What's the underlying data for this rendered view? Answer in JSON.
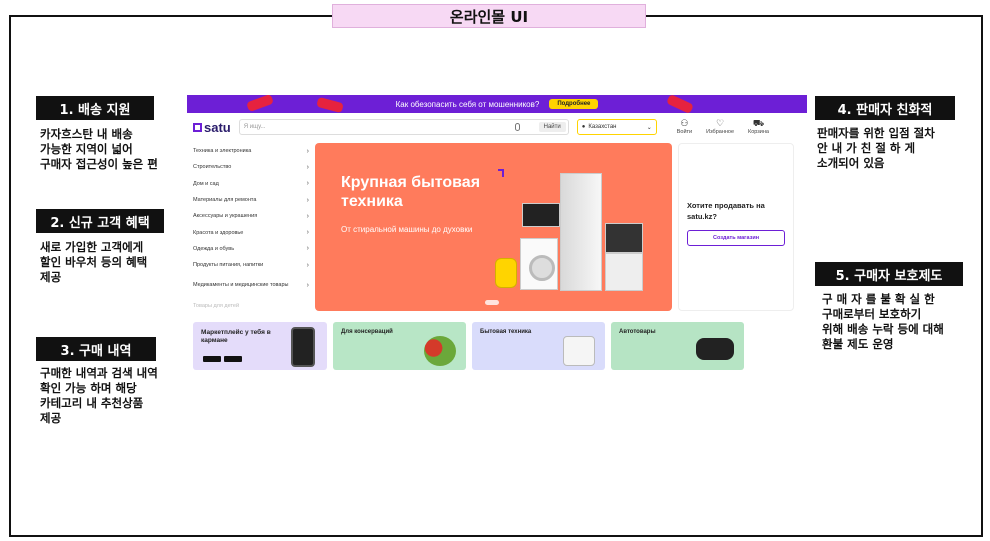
{
  "page": {
    "title": "온라인몰 UI"
  },
  "annotations": [
    {
      "label": "1. 배송 지원",
      "note": "카자흐스탄 내 배송\n가능한 지역이 넓어\n구매자 접근성이 높은 편"
    },
    {
      "label": "2. 신규 고객 혜택",
      "note": "새로 가입한 고객에게\n할인 바우처 등의 혜택\n제공"
    },
    {
      "label": "3. 구매 내역",
      "note": "구매한 내역과 검색 내역\n확인 가능 하며 해당\n카테고리 내 추천상품\n제공"
    },
    {
      "label": "4. 판매자 친화적",
      "note": "판매자를 위한 입점 절차\n안 내 가  친 절 하 게\n소개되어 있음"
    },
    {
      "label": "5. 구매자 보호제도",
      "note": "구 매 자 를  불 확 실 한\n구매로부터 보호하기\n위해 배송 누락 등에 대해\n환불 제도 운영"
    }
  ],
  "site": {
    "banner": {
      "text": "Как обезопасить себя от мошенников?",
      "button": "Подробнее",
      "color": "#6d1fd6"
    },
    "logo": "satu",
    "search": {
      "placeholder": "Я ищу...",
      "button": "Найти"
    },
    "region": "Казахстан",
    "header_icons": [
      {
        "icon": "user-icon",
        "label": "Войти"
      },
      {
        "icon": "heart-icon",
        "label": "Избранное"
      },
      {
        "icon": "cart-icon",
        "label": "Корзина"
      }
    ],
    "categories": [
      "Техника и электроника",
      "Строительство",
      "Дом и сад",
      "Материалы для ремонта",
      "Аксессуары и украшения",
      "Красота и здоровье",
      "Одежда и обувь",
      "Продукты питания, напитки",
      "Медикаменты и медицинские товары",
      "Товары для детей"
    ],
    "hero": {
      "title": "Крупная бытовая техника",
      "subtitle": "От стиральной машины до духовки",
      "color": "#ff7b5c"
    },
    "seller": {
      "title": "Хотите продавать на satu.kz?",
      "button": "Создать магазин"
    },
    "promos": [
      {
        "title": "Маркетплейс у тебя в кармане"
      },
      {
        "title": "Для консерваций"
      },
      {
        "title": "Бытовая техника"
      },
      {
        "title": "Автотовары"
      }
    ]
  }
}
